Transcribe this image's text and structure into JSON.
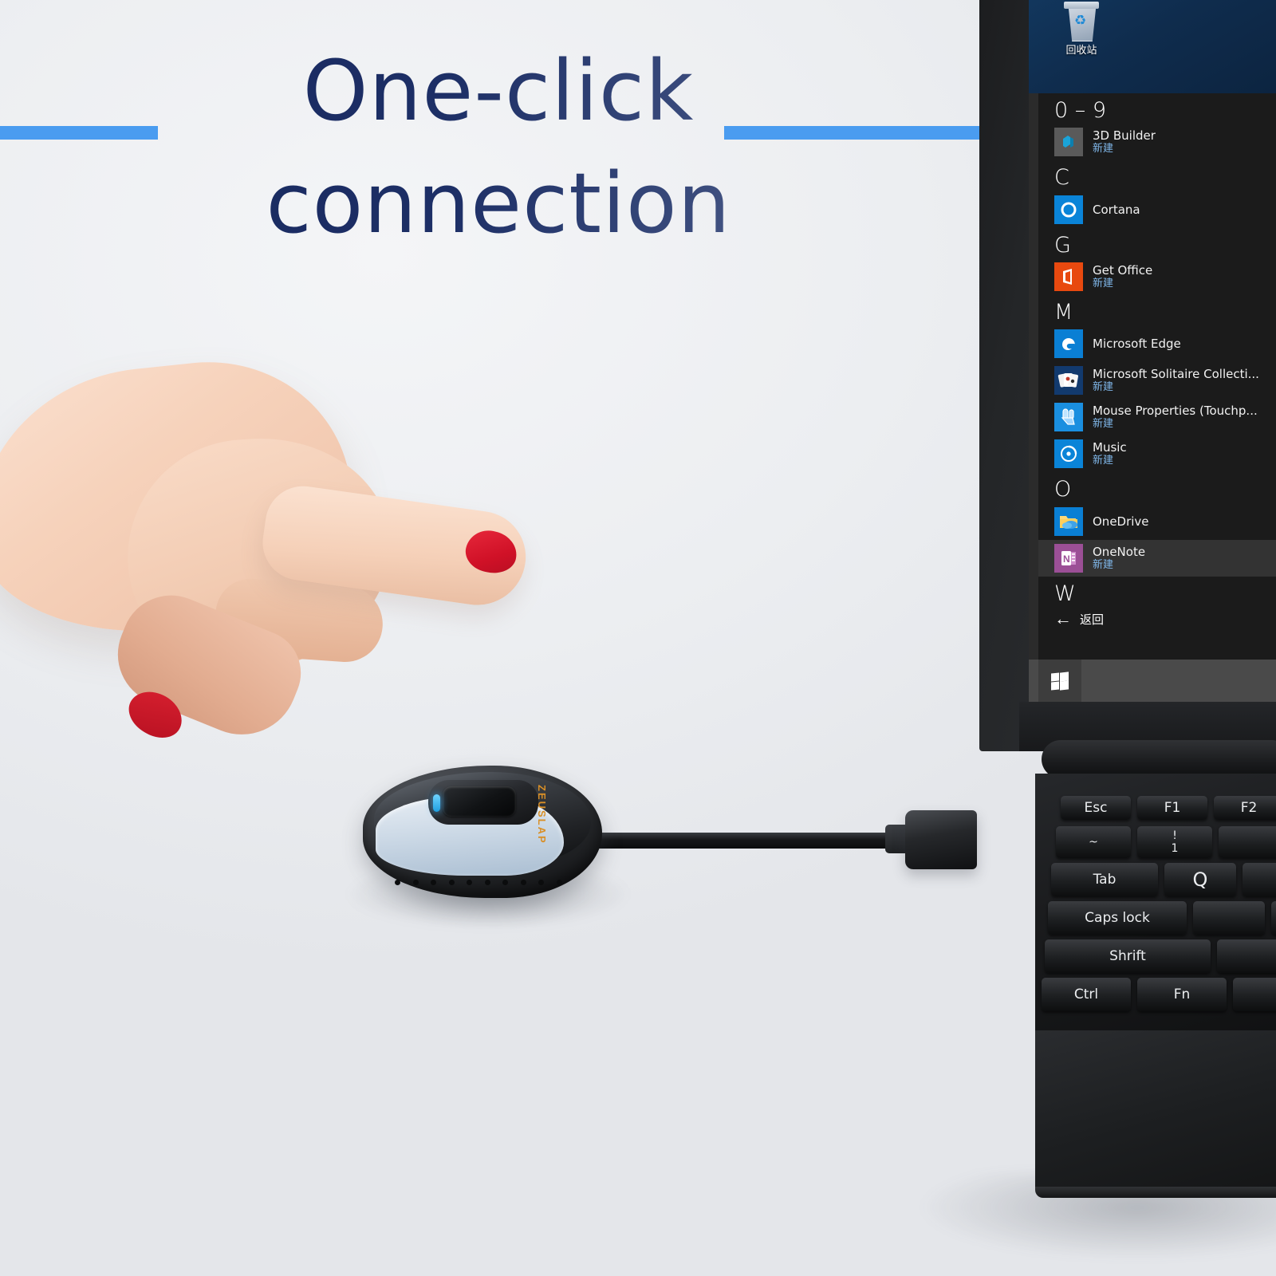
{
  "marketing": {
    "headline_line1": "One-click",
    "headline_line2": "connection",
    "accent_color": "#4a9cf0",
    "headline_color": "#16265c",
    "background_color": "#eceef1"
  },
  "device": {
    "brand": "ZEUSLAP",
    "brand_color": "#d98f26",
    "led_color": "#3cb4ff"
  },
  "laptop": {
    "desktop": {
      "recycle_bin_label": "回收站",
      "wallpaper_color": "#0f2c4d"
    },
    "start_menu": {
      "sections": [
        {
          "header": "0 – 9",
          "apps": [
            {
              "name": "3D Builder",
              "sub": "新建",
              "icon": "3d-builder-icon",
              "tile_color": "#5a5a5a",
              "selected": false
            }
          ]
        },
        {
          "header": "C",
          "apps": [
            {
              "name": "Cortana",
              "sub": "",
              "icon": "cortana-icon",
              "tile_color": "#0a84d8",
              "selected": false
            }
          ]
        },
        {
          "header": "G",
          "apps": [
            {
              "name": "Get Office",
              "sub": "新建",
              "icon": "office-icon",
              "tile_color": "#e8490f",
              "selected": false
            }
          ]
        },
        {
          "header": "M",
          "apps": [
            {
              "name": "Microsoft Edge",
              "sub": "",
              "icon": "edge-icon",
              "tile_color": "#0a7fd4",
              "selected": false
            },
            {
              "name": "Microsoft Solitaire Collecti...",
              "sub": "新建",
              "icon": "solitaire-icon",
              "tile_color": "#123a6e",
              "selected": false
            },
            {
              "name": "Mouse Properties (Touchp...",
              "sub": "新建",
              "icon": "mouse-properties-icon",
              "tile_color": "#1a8fe0",
              "selected": false
            },
            {
              "name": "Music",
              "sub": "新建",
              "icon": "music-icon",
              "tile_color": "#0a84d8",
              "selected": false
            }
          ]
        },
        {
          "header": "O",
          "apps": [
            {
              "name": "OneDrive",
              "sub": "",
              "icon": "onedrive-icon",
              "tile_color": "#0a7fd4",
              "selected": false
            },
            {
              "name": "OneNote",
              "sub": "新建",
              "icon": "onenote-icon",
              "tile_color": "#9b4f96",
              "selected": true
            }
          ]
        },
        {
          "header": "W",
          "apps": []
        }
      ],
      "back_label": "返回",
      "back_icon": "arrow-left-icon"
    },
    "taskbar": {
      "start_button_icon": "windows-logo-icon"
    },
    "keyboard": {
      "row_fn": [
        "Esc",
        "F1",
        "F2"
      ],
      "row_num_keys": [
        {
          "top": "~",
          "bottom": ""
        },
        {
          "top": "!",
          "bottom": "1"
        }
      ],
      "row_tab": [
        "Tab",
        "Q"
      ],
      "row_caps": [
        "Caps lock"
      ],
      "row_shift": [
        "Shrift"
      ],
      "row_ctrl": [
        "Ctrl",
        "Fn"
      ]
    }
  }
}
